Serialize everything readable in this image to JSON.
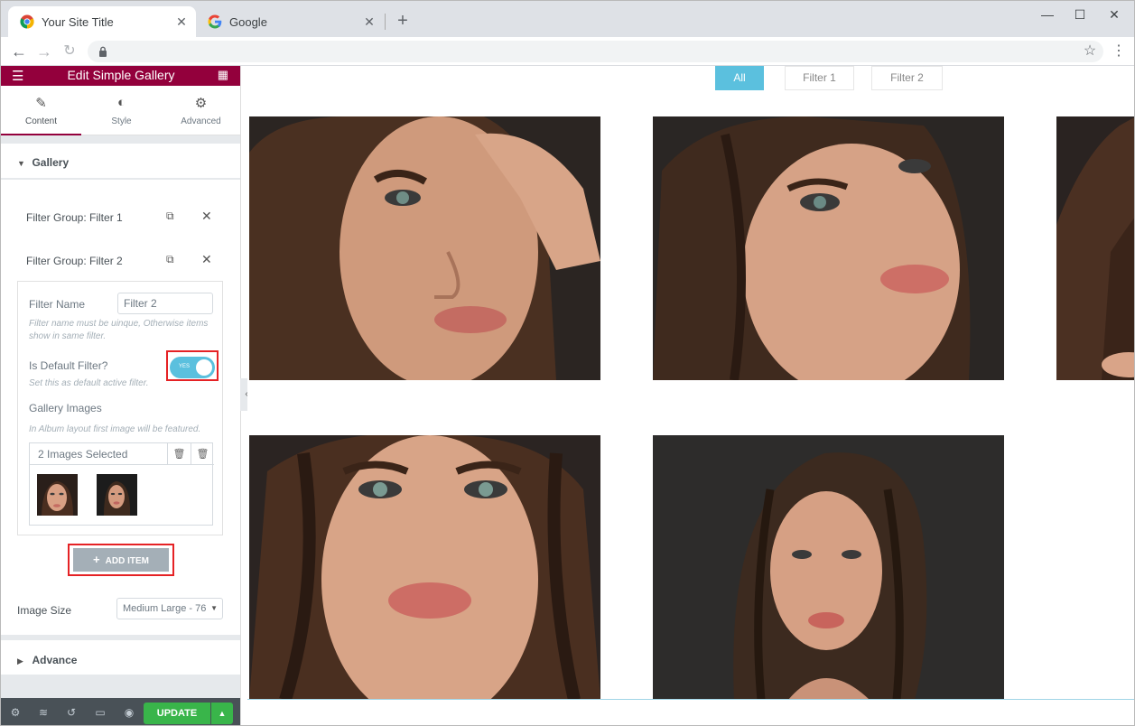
{
  "browser": {
    "tabs": [
      {
        "title": "Your Site Title",
        "active": true
      },
      {
        "title": "Google",
        "active": false
      }
    ],
    "new_tab_symbol": "+",
    "window_controls": [
      "—",
      "☐",
      "✕"
    ]
  },
  "panel": {
    "header_title": "Edit Simple Gallery",
    "tabs": [
      {
        "label": "Content",
        "icon": "pencil-icon"
      },
      {
        "label": "Style",
        "icon": "half-circle-icon"
      },
      {
        "label": "Advanced",
        "icon": "gear-icon"
      }
    ],
    "gallery_section": "Gallery",
    "filter_groups": [
      "Filter Group: Filter 1",
      "Filter Group: Filter 2"
    ],
    "filter_name_label": "Filter Name",
    "filter_name_value": "Filter 2",
    "filter_name_help": "Filter name must be uinque, Otherwise items show in same filter.",
    "default_filter_label": "Is Default Filter?",
    "default_filter_toggle": "YES",
    "default_filter_help": "Set this as default active filter.",
    "gallery_images_label": "Gallery Images",
    "gallery_images_help": "In Album layout first image will be featured.",
    "images_selected": "2 Images Selected",
    "add_item_label": "ADD ITEM",
    "image_size_label": "Image Size",
    "image_size_value": "Medium Large - 76",
    "advance_section": "Advance",
    "update_label": "UPDATE"
  },
  "preview": {
    "filters": [
      {
        "label": "All",
        "active": true
      },
      {
        "label": "Filter 1",
        "active": false
      },
      {
        "label": "Filter 2",
        "active": false
      }
    ]
  },
  "colors": {
    "elementor_header": "#93003c",
    "accent_blue": "#5bc0de",
    "update_green": "#39b54a",
    "highlight_red": "#e52225"
  }
}
